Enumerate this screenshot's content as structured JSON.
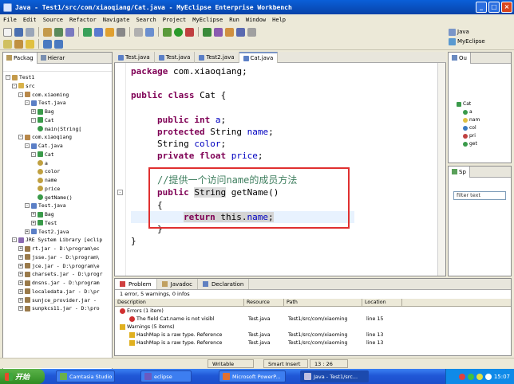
{
  "window": {
    "title": "Java - Test1/src/com/xiaoqiang/Cat.java - MyEclipse Enterprise Workbench",
    "min": "_",
    "max": "□",
    "close": "×"
  },
  "menu": [
    "File",
    "Edit",
    "Source",
    "Refactor",
    "Navigate",
    "Search",
    "Project",
    "MyEclipse",
    "Run",
    "Window",
    "Help"
  ],
  "perspectives": {
    "java": "Java",
    "myeclipse": "MyEclipse"
  },
  "left_panel": {
    "tabs": [
      "Packag",
      "Hierar"
    ],
    "tree": [
      {
        "label": "Test1",
        "depth": 0,
        "toggle": "-",
        "icon": "project-icon"
      },
      {
        "label": "src",
        "depth": 1,
        "toggle": "-",
        "icon": "folder-icon"
      },
      {
        "label": "com.xiaoming",
        "depth": 2,
        "toggle": "-",
        "icon": "package-icon"
      },
      {
        "label": "Test.java",
        "depth": 3,
        "toggle": "-",
        "icon": "java-file-icon"
      },
      {
        "label": "Bag",
        "depth": 4,
        "toggle": "+",
        "icon": "class-icon"
      },
      {
        "label": "Cat",
        "depth": 4,
        "toggle": "-",
        "icon": "class-icon"
      },
      {
        "label": "main(String[",
        "depth": 5,
        "toggle": "",
        "icon": "method-icon"
      },
      {
        "label": "com.xiaoqiang",
        "depth": 2,
        "toggle": "-",
        "icon": "package-icon"
      },
      {
        "label": "Cat.java",
        "depth": 3,
        "toggle": "-",
        "icon": "java-file-icon"
      },
      {
        "label": "Cat",
        "depth": 4,
        "toggle": "-",
        "icon": "class-icon"
      },
      {
        "label": "a",
        "depth": 5,
        "toggle": "",
        "icon": "field-icon"
      },
      {
        "label": "color",
        "depth": 5,
        "toggle": "",
        "icon": "field-icon"
      },
      {
        "label": "name",
        "depth": 5,
        "toggle": "",
        "icon": "field-icon"
      },
      {
        "label": "price",
        "depth": 5,
        "toggle": "",
        "icon": "field-icon"
      },
      {
        "label": "getName()",
        "depth": 5,
        "toggle": "",
        "icon": "method-icon"
      },
      {
        "label": "Test.java",
        "depth": 3,
        "toggle": "-",
        "icon": "java-file-icon"
      },
      {
        "label": "Bag",
        "depth": 4,
        "toggle": "+",
        "icon": "class-icon"
      },
      {
        "label": "Test",
        "depth": 4,
        "toggle": "+",
        "icon": "class-icon"
      },
      {
        "label": "Test2.java",
        "depth": 3,
        "toggle": "+",
        "icon": "java-file-icon"
      },
      {
        "label": "JRE System Library [eclip",
        "depth": 1,
        "toggle": "-",
        "icon": "library-icon"
      },
      {
        "label": "rt.jar - D:\\program\\ec",
        "depth": 2,
        "toggle": "+",
        "icon": "jar-icon"
      },
      {
        "label": "jsse.jar - D:\\program\\",
        "depth": 2,
        "toggle": "+",
        "icon": "jar-icon"
      },
      {
        "label": "jce.jar - D:\\program\\e",
        "depth": 2,
        "toggle": "+",
        "icon": "jar-icon"
      },
      {
        "label": "charsets.jar - D:\\progr",
        "depth": 2,
        "toggle": "+",
        "icon": "jar-icon"
      },
      {
        "label": "dnsns.jar - D:\\program",
        "depth": 2,
        "toggle": "+",
        "icon": "jar-icon"
      },
      {
        "label": "localedata.jar - D:\\pr",
        "depth": 2,
        "toggle": "+",
        "icon": "jar-icon"
      },
      {
        "label": "sunjce_provider.jar - ",
        "depth": 2,
        "toggle": "+",
        "icon": "jar-icon"
      },
      {
        "label": "sunpkcs11.jar - D:\\pro",
        "depth": 2,
        "toggle": "+",
        "icon": "jar-icon"
      }
    ]
  },
  "editor": {
    "tabs": [
      "Test.java",
      "Test.java",
      "Test2.java",
      "Cat.java"
    ],
    "active_tab": 3,
    "lines": {
      "package_kw": "package",
      "package_rest": " com.xiaoqiang;",
      "class_kw1": "public",
      "class_kw2": "class",
      "class_rest": " Cat {",
      "f1_kw1": "public",
      "f1_kw2": "int",
      "f1_name": "a",
      "f1_end": ";",
      "f2_kw": "protected",
      "f2_type": " String ",
      "f2_name": "name",
      "f2_end": ";",
      "f3_type": "String ",
      "f3_name": "color",
      "f3_end": ";",
      "f4_kw1": "private",
      "f4_kw2": "float",
      "f4_name": "price",
      "f4_end": ";",
      "comment": "//提供一个访问name的成员方法",
      "m_kw": "public",
      "m_type": "String",
      "m_rest": " getName()",
      "open_brace": "{",
      "ret_kw": "return",
      "ret_this": " this.",
      "ret_field": "name",
      "ret_end": ";",
      "close_brace": "}",
      "class_close": "}"
    }
  },
  "outline": {
    "tab": "Ou",
    "root": "Cat",
    "items": [
      "a",
      "nam",
      "col",
      "pri",
      "get"
    ]
  },
  "spring": {
    "tab": "Sp",
    "filter_placeholder": "filter text"
  },
  "problems": {
    "tabs": [
      "Problem",
      "Javadoc",
      "Declaration"
    ],
    "summary": "1 error, 5 warnings, 0 infos",
    "columns": [
      "Description",
      "Resource",
      "Path",
      "Location"
    ],
    "rows": [
      {
        "kind": "group-error",
        "desc": "Errors (1 item)",
        "resource": "",
        "path": "",
        "location": ""
      },
      {
        "kind": "error",
        "desc": "The field Cat.name is not visibl",
        "resource": "Test.java",
        "path": "Test1/src/com/xiaoming",
        "location": "line 15"
      },
      {
        "kind": "group-warning",
        "desc": "Warnings (5 items)",
        "resource": "",
        "path": "",
        "location": ""
      },
      {
        "kind": "warning",
        "desc": "HashMap is a raw type. Reference",
        "resource": "Test.java",
        "path": "Test1/src/com/xiaoming",
        "location": "line 13"
      },
      {
        "kind": "warning",
        "desc": "HashMap is a raw type. Reference",
        "resource": "Test.java",
        "path": "Test1/src/com/xiaoming",
        "location": "line 13"
      }
    ]
  },
  "statusbar": {
    "writable": "Writable",
    "insert": "Smart Insert",
    "position": "13 : 26"
  },
  "taskbar": {
    "start": "开始",
    "tasks": [
      "Camtasia Studio ...",
      "eclipse",
      "Microsoft PowerP...",
      "Java - Test1/src..."
    ],
    "clock": "15:07"
  },
  "colors": {
    "keyword": "#7f0055",
    "comment": "#3f7f5f",
    "field": "#0000c0",
    "highlight_box": "#e03030",
    "titlebar": "#0a5fd8"
  }
}
